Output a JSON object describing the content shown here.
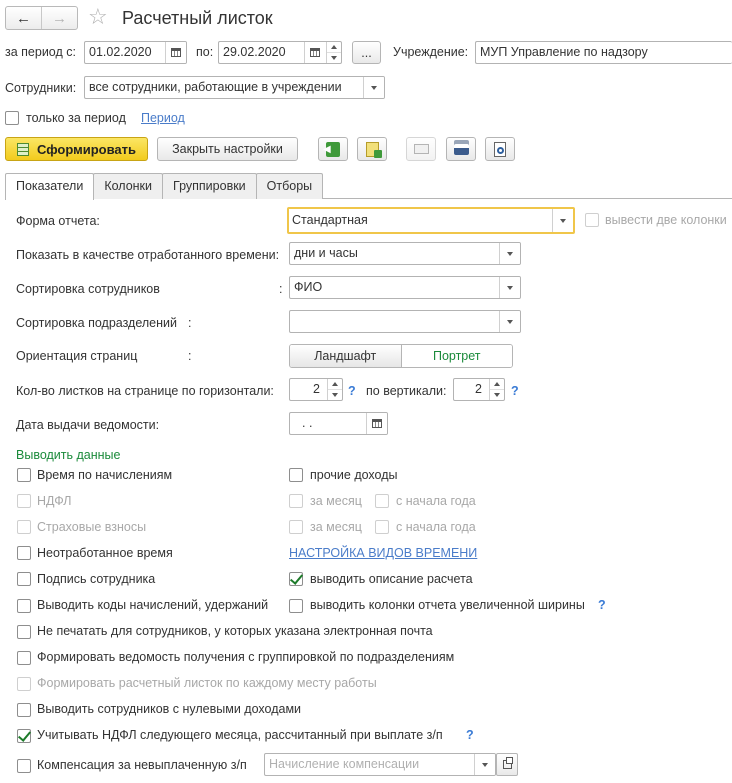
{
  "window": {
    "title": "Расчетный листок"
  },
  "period": {
    "from_label": "за период с:",
    "from_value": "01.02.2020",
    "to_label": "по:",
    "to_value": "29.02.2020",
    "dots": "...",
    "org_label": "Учреждение:",
    "org_value": "МУП Управление по надзору"
  },
  "employees": {
    "label": "Сотрудники:",
    "value": "все сотрудники, работающие в учреждении"
  },
  "only_period": {
    "label": "только за период",
    "link": "Период"
  },
  "toolbar": {
    "generate": "Сформировать",
    "close_settings": "Закрыть настройки"
  },
  "tabs": [
    "Показатели",
    "Колонки",
    "Группировки",
    "Отборы"
  ],
  "form": {
    "report_form_label": "Форма отчета:",
    "report_form_value": "Стандартная",
    "two_columns": "вывести две колонки",
    "worked_time_label": "Показать в качестве отработанного времени:",
    "worked_time_value": "дни и часы",
    "sort_employees_label": "Сортировка сотрудников",
    "sort_employees_value": "ФИО",
    "sort_departments_label": "Сортировка подразделений",
    "sort_departments_value": "",
    "orientation_label": "Ориентация страниц",
    "landscape": "Ландшафт",
    "portrait": "Портрет",
    "sheets_h_label": "Кол-во листков на странице по горизонтали:",
    "sheets_h_value": "2",
    "sheets_v_label": "по вертикали:",
    "sheets_v_value": "2",
    "issue_date_label": "Дата выдачи ведомости:",
    "issue_date_value": " .  ."
  },
  "output": {
    "title": "Выводить данные",
    "time_by_accruals": "Время по начислениям",
    "other_income": "прочие доходы",
    "ndfl": "НДФЛ",
    "per_month": "за месяц",
    "from_year_start": "с начала года",
    "insurance": "Страховые взносы",
    "unworked_time": "Неотработанное время",
    "time_types_link": "НАСТРОЙКА ВИДОВ ВРЕМЕНИ",
    "employee_signature": "Подпись сотрудника",
    "show_description": "выводить описание расчета",
    "show_codes": "Выводить коды начислений, удержаний",
    "wide_columns": "выводить колонки отчета увеличенной ширины",
    "no_print_email": "Не печатать для сотрудников, у которых указана электронная почта",
    "statement_grouping": "Формировать ведомость получения с группировкой по подразделениям",
    "each_workplace": "Формировать расчетный листок по каждому месту работы",
    "zero_income": "Выводить сотрудников с нулевыми доходами",
    "next_month_ndfl": "Учитывать НДФЛ следующего месяца, рассчитанный при выплате з/п",
    "compensation_label": "Компенсация за невыплаченную з/п",
    "compensation_placeholder": "Начисление компенсации"
  },
  "colon": ":",
  "question": "?"
}
